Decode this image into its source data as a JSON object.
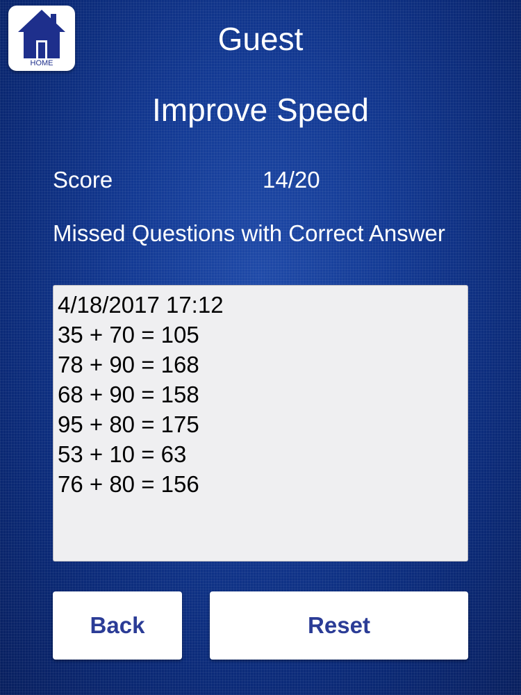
{
  "header": {
    "home_label": "HOME",
    "user_name": "Guest",
    "title": "Improve Speed"
  },
  "score": {
    "label": "Score",
    "value": "14/20"
  },
  "missed": {
    "heading": "Missed Questions with Correct Answer",
    "lines": [
      "4/18/2017 17:12",
      "35 + 70 = 105",
      "78 + 90 = 168",
      "68 + 90 = 158",
      "95 + 80 = 175",
      "53 + 10 = 63",
      "76 + 80 = 156"
    ]
  },
  "buttons": {
    "back_label": "Back",
    "reset_label": "Reset"
  },
  "colors": {
    "background": "#133a94",
    "button_text": "#2b3c96",
    "home_icon": "#1e2f8c",
    "results_box": "#efeff1"
  }
}
